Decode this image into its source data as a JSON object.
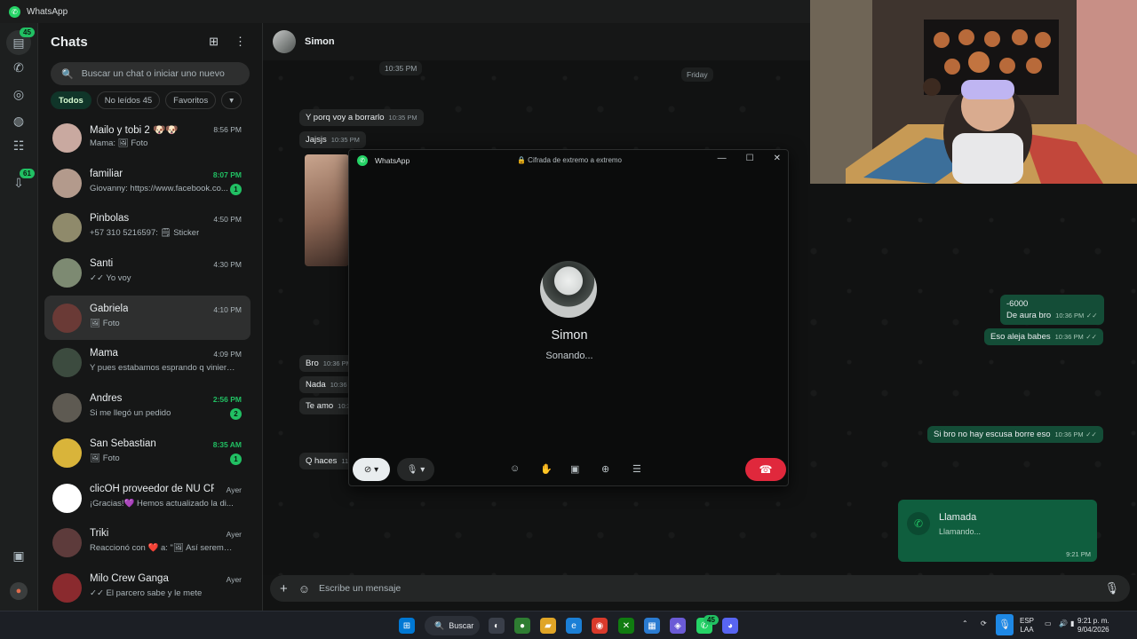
{
  "window": {
    "title": "WhatsApp"
  },
  "rail": {
    "chats_badge": "45",
    "updates_badge": "61"
  },
  "chats_panel": {
    "title": "Chats",
    "search_placeholder": "Buscar un chat o iniciar uno nuevo",
    "filters": [
      "Todos",
      "No leídos 45",
      "Favoritos"
    ],
    "items": [
      {
        "name": "Mailo y tobi 2 🐶🐶",
        "time": "8:56 PM",
        "preview": "Mama: 🖼 Foto",
        "unread": "",
        "color": "#c9a9a0"
      },
      {
        "name": "familiar",
        "time": "8:07 PM",
        "preview": "Giovanny: https://www.facebook.co...",
        "unread": "1",
        "color": "#b39a8c"
      },
      {
        "name": "Pinbolas",
        "time": "4:50 PM",
        "preview": "+57 310 5216597: 🗒 Sticker",
        "unread": "",
        "color": "#8f8a6b"
      },
      {
        "name": "Santi",
        "time": "4:30 PM",
        "preview": "✓✓ Yo voy",
        "unread": "",
        "color": "#7d8a72"
      },
      {
        "name": "Gabriela",
        "time": "4:10 PM",
        "preview": "🖼 Foto",
        "unread": "",
        "color": "#6a3a36"
      },
      {
        "name": "Mama",
        "time": "4:09 PM",
        "preview": "Y pues estabamos esprando q viniera ...",
        "unread": "",
        "color": "#3c4b3f"
      },
      {
        "name": "Andres",
        "time": "2:56 PM",
        "preview": "Si me llegó un pedido",
        "unread": "2",
        "color": "#5e5a52"
      },
      {
        "name": "San Sebastian",
        "time": "8:35 AM",
        "preview": "🖼 Foto",
        "unread": "1",
        "color": "#d9b43a"
      },
      {
        "name": "clicOH proveedor de NU CF",
        "time": "Ayer",
        "preview": "¡Gracias!💜 Hemos actualizado la di...",
        "unread": "",
        "color": "#ffffff"
      },
      {
        "name": "Triki",
        "time": "Ayer",
        "preview": "Reaccionó con ❤️ a: \"🖼 Así seremos...",
        "unread": "",
        "color": "#5d3b3b"
      },
      {
        "name": "Milo Crew Ganga",
        "time": "Ayer",
        "preview": "✓✓ El parcero sabe y le mete",
        "unread": "",
        "color": "#8a2a2e"
      }
    ]
  },
  "conversation": {
    "contact": "Simon",
    "date_pills": [
      "10:35 PM",
      "Friday"
    ],
    "incoming": [
      {
        "text": "Y porq voy a borrarlo",
        "time": "10:35 PM"
      },
      {
        "text": "Jajsjs",
        "time": "10:35 PM"
      },
      {
        "text": "Bro",
        "time": "10:36 PM"
      },
      {
        "text": "Nada",
        "time": "10:36 PM"
      },
      {
        "text": "Te amo",
        "time": "10:36 PM"
      },
      {
        "text": "Q haces",
        "time": "11:..."
      }
    ],
    "outgoing": [
      {
        "line1": "-6000",
        "line2": "De aura bro",
        "time": "10:36 PM"
      },
      {
        "text": "Eso aleja babes",
        "time": "10:36 PM"
      },
      {
        "text": "Si bro no hay escusa borre eso",
        "time": "10:36 PM"
      }
    ],
    "call_card": {
      "title": "Llamada",
      "status": "Llamando...",
      "time": "9:21 PM"
    },
    "composer_placeholder": "Escribe un mensaje"
  },
  "call_window": {
    "app": "WhatsApp",
    "encryption": "🔒 Cifrada de extremo a extremo",
    "contact": "Simon",
    "status": "Sonando..."
  },
  "taskbar": {
    "search_label": "Buscar",
    "whatsapp_badge": "45",
    "lang": "ESP",
    "layout": "LAA",
    "time": "9:21 p. m.",
    "date": "9/04/2026"
  }
}
